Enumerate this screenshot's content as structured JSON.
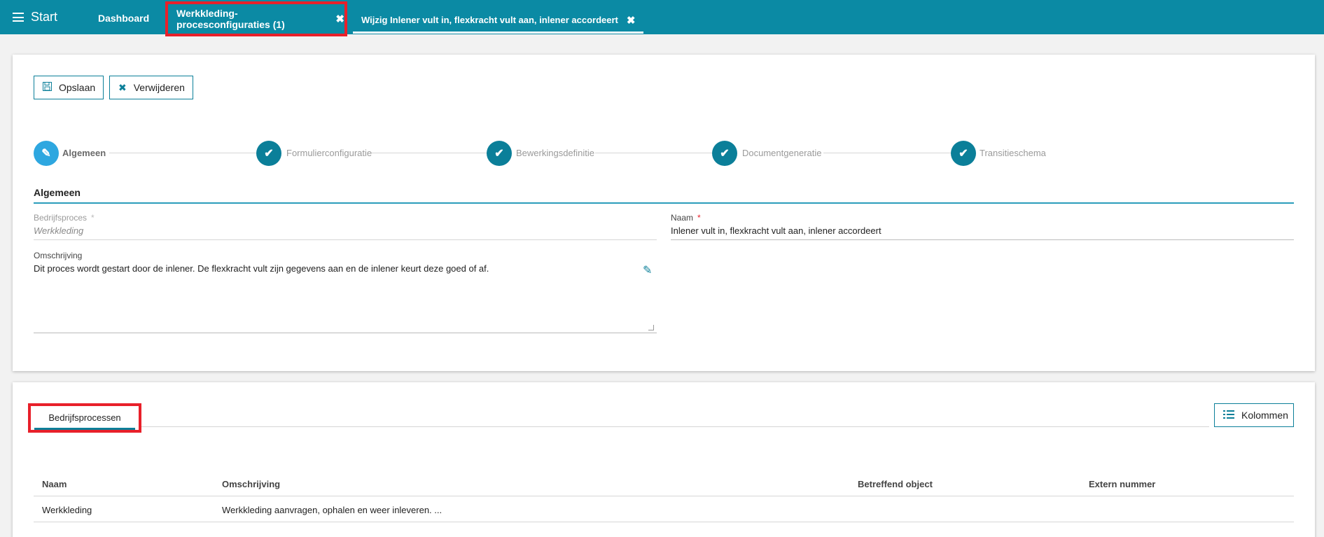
{
  "topbar": {
    "start_label": "Start",
    "tabs": [
      {
        "label": "Dashboard"
      },
      {
        "label": "Werkkleding-procesconfiguraties (1)"
      },
      {
        "label": "Wijzig Inlener vult in, flexkracht vult aan, inlener accordeert"
      }
    ]
  },
  "toolbar": {
    "save_label": "Opslaan",
    "delete_label": "Verwijderen"
  },
  "stepper": [
    {
      "label": "Algemeen",
      "state": "active",
      "icon": "pencil-icon"
    },
    {
      "label": "Formulierconfiguratie",
      "state": "done",
      "icon": "check-icon"
    },
    {
      "label": "Bewerkingsdefinitie",
      "state": "done",
      "icon": "check-icon"
    },
    {
      "label": "Documentgeneratie",
      "state": "done",
      "icon": "check-icon"
    },
    {
      "label": "Transitieschema",
      "state": "done",
      "icon": "check-icon"
    }
  ],
  "form": {
    "section_title": "Algemeen",
    "bedrijfsproces": {
      "label": "Bedrijfsproces",
      "required": "*",
      "value": "Werkkleding"
    },
    "naam": {
      "label": "Naam",
      "required": "*",
      "value": "Inlener vult in, flexkracht vult aan, inlener accordeert"
    },
    "omschrijving": {
      "label": "Omschrijving",
      "value": "Dit proces wordt gestart door de inlener. De flexkracht vult zijn gegevens aan en de inlener keurt deze goed of af."
    }
  },
  "table_section": {
    "tab_label": "Bedrijfsprocessen",
    "columns_button": "Kolommen",
    "headers": [
      "Naam",
      "Omschrijving",
      "Betreffend object",
      "Extern nummer"
    ],
    "rows": [
      [
        "Werkkleding",
        "Werkkleding aanvragen, ophalen en weer inleveren. ...",
        "",
        ""
      ]
    ]
  },
  "colors": {
    "primary": "#0b8aa4",
    "accent": "#0b7f99",
    "active_step": "#2ea7e0",
    "highlight": "#e8202a"
  }
}
